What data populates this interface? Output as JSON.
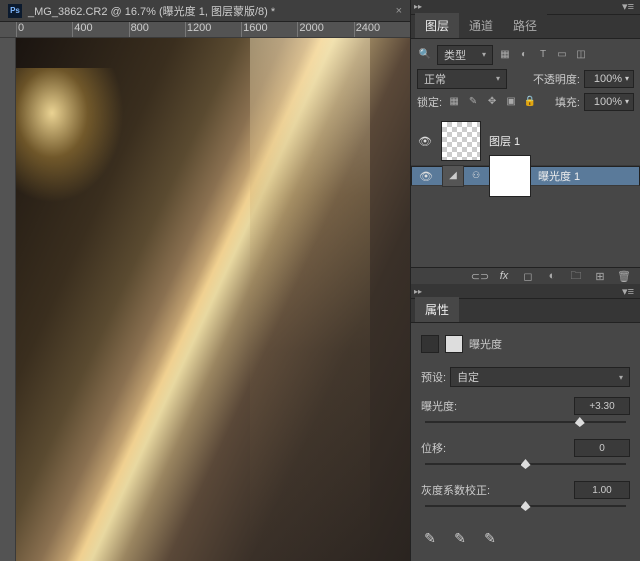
{
  "doc": {
    "title": "_MG_3862.CR2 @ 16.7% (曝光度 1, 图层蒙版/8) *"
  },
  "ruler": {
    "marks": [
      "0",
      "400",
      "800",
      "1200",
      "1600",
      "2000",
      "2400"
    ]
  },
  "panels": {
    "layers_tabs": [
      "图层",
      "通道",
      "路径"
    ],
    "layers_active": 0,
    "filter_label": "类型",
    "blend_mode": "正常",
    "opacity_label": "不透明度:",
    "opacity_value": "100%",
    "lock_label": "锁定:",
    "fill_label": "填充:",
    "fill_value": "100%",
    "layers": [
      {
        "name": "图层 1",
        "visible": true,
        "thumb": "trans"
      },
      {
        "name": "曝光度 1",
        "visible": true,
        "thumb": "adj",
        "mask": true,
        "selected": true
      }
    ]
  },
  "props": {
    "tab": "属性",
    "title": "曝光度",
    "preset_label": "预设:",
    "preset_value": "自定",
    "sliders": [
      {
        "label": "曝光度:",
        "value": "+3.30",
        "pos": 0.77
      },
      {
        "label": "位移:",
        "value": "0",
        "pos": 0.5
      },
      {
        "label": "灰度系数校正:",
        "value": "1.00",
        "pos": 0.5
      }
    ]
  }
}
